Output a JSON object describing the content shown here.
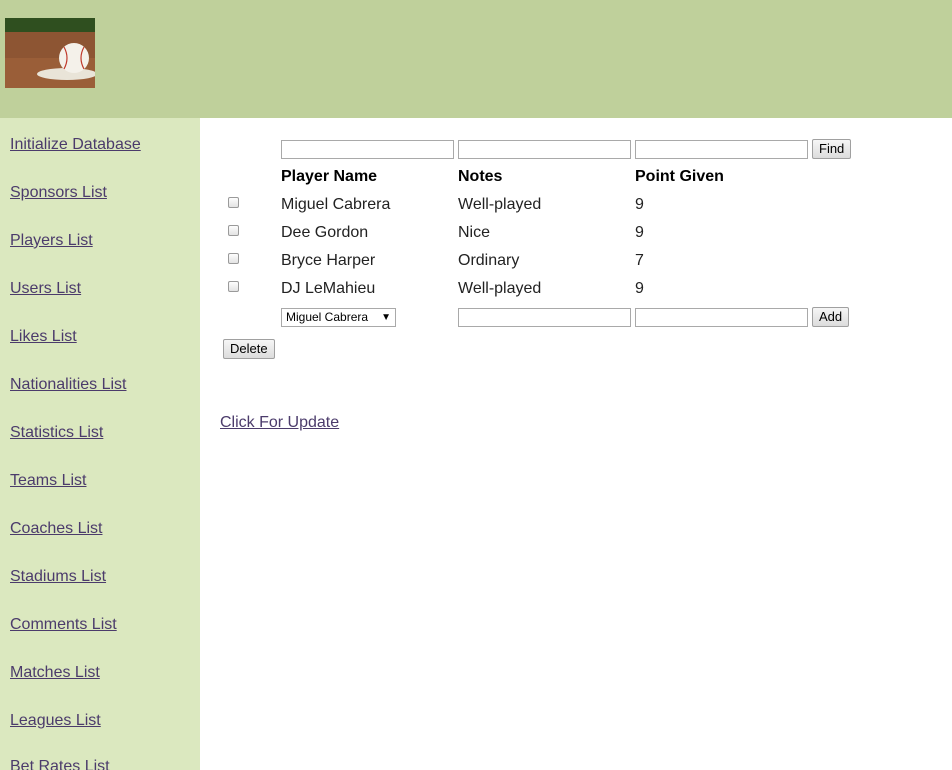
{
  "sidebar": {
    "items": [
      {
        "label": "Initialize Database"
      },
      {
        "label": "Sponsors List"
      },
      {
        "label": "Players List"
      },
      {
        "label": "Users List"
      },
      {
        "label": "Likes List"
      },
      {
        "label": "Nationalities List"
      },
      {
        "label": "Statistics List"
      },
      {
        "label": "Teams List"
      },
      {
        "label": "Coaches List"
      },
      {
        "label": "Stadiums List"
      },
      {
        "label": "Comments List"
      },
      {
        "label": "Matches List"
      },
      {
        "label": "Leagues List"
      },
      {
        "label": "Bet Rates List"
      }
    ]
  },
  "search": {
    "find_label": "Find",
    "player_value": "",
    "notes_value": "",
    "points_value": ""
  },
  "table": {
    "headers": [
      "Player Name",
      "Notes",
      "Point Given"
    ],
    "rows": [
      {
        "player": "Miguel Cabrera",
        "notes": "Well-played",
        "points": "9"
      },
      {
        "player": "Dee Gordon",
        "notes": "Nice",
        "points": "9"
      },
      {
        "player": "Bryce Harper",
        "notes": "Ordinary",
        "points": "7"
      },
      {
        "player": "DJ LeMahieu",
        "notes": "Well-played",
        "points": "9"
      }
    ]
  },
  "add_form": {
    "player_selected": "Miguel Cabrera",
    "notes_value": "",
    "points_value": "",
    "add_label": "Add"
  },
  "delete_label": "Delete",
  "update_link": "Click For Update",
  "colors": {
    "header_bg": "#bfd09b",
    "sidebar_bg": "#dbe8bf",
    "link": "#4b3b6b"
  }
}
